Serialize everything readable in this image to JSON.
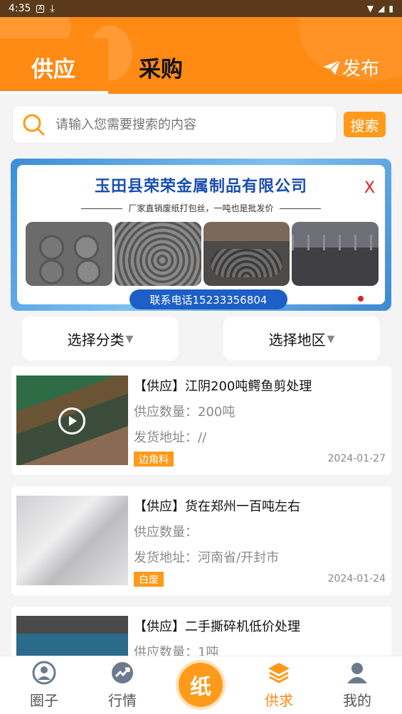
{
  "status_bar": {
    "time": "4:35"
  },
  "header": {
    "tabs": [
      {
        "label": "供应"
      },
      {
        "label": "采购"
      }
    ],
    "publish_label": "发布"
  },
  "search": {
    "placeholder": "请输入您需要搜索的内容",
    "button_label": "搜索"
  },
  "banner": {
    "company": "玉田县荣荣金属制品有限公司",
    "slogan": "厂家直销废纸打包丝，一吨也是批发价",
    "phone": "联系电话15233356804",
    "close_label": "X"
  },
  "filters": {
    "category_label": "选择分类",
    "region_label": "选择地区"
  },
  "listings": [
    {
      "title": "【供应】江阴200吨鳄鱼剪处理",
      "qty": "供应数量：200吨",
      "address": "发货地址：//",
      "tag": "边角料",
      "date": "2024-01-27",
      "has_video": true
    },
    {
      "title": "【供应】货在郑州一百吨左右",
      "qty": "供应数量：",
      "address": "发货地址：河南省/开封市",
      "tag": "白废",
      "date": "2024-01-24",
      "has_video": false
    },
    {
      "title": "【供应】二手撕碎机低价处理",
      "qty": "供应数量：1吨",
      "address": "",
      "tag": "",
      "date": "",
      "has_video": false
    }
  ],
  "bottom_nav": {
    "items": [
      {
        "label": "圈子",
        "icon": "person-circle-icon"
      },
      {
        "label": "行情",
        "icon": "trend-chart-icon"
      },
      {
        "label": "纸",
        "icon": "center-paper-icon"
      },
      {
        "label": "供求",
        "icon": "layers-icon",
        "active": true
      },
      {
        "label": "我的",
        "icon": "user-icon"
      }
    ]
  },
  "colors": {
    "brand_orange": "#ff8a14",
    "accent_orange": "#ff9a1a",
    "blue": "#1d5ec7"
  }
}
